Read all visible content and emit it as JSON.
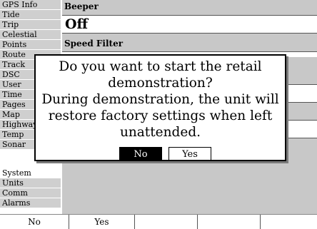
{
  "sidebar": {
    "items": [
      {
        "label": "GPS Info"
      },
      {
        "label": "Tide"
      },
      {
        "label": "Trip"
      },
      {
        "label": "Celestial"
      },
      {
        "label": "Points"
      },
      {
        "label": "Route"
      },
      {
        "label": "Track"
      },
      {
        "label": "DSC"
      },
      {
        "label": "User"
      },
      {
        "label": "Time"
      },
      {
        "label": "Pages"
      },
      {
        "label": "Map"
      },
      {
        "label": "Highway"
      },
      {
        "label": "Temp"
      },
      {
        "label": "Sonar"
      },
      {
        "label": "System"
      },
      {
        "label": "Units"
      },
      {
        "label": "Comm"
      },
      {
        "label": "Alarms"
      }
    ],
    "selected": "System"
  },
  "main": {
    "beeper_label": "Beeper",
    "beeper_value": "Off",
    "speed_filter_label": "Speed Filter"
  },
  "dialog": {
    "message_line1": "Do you want to start the retail",
    "message_line2": "demonstration?",
    "message_line3": "During demonstration, the unit will",
    "message_line4": "restore factory settings when left",
    "message_line5": "unattended.",
    "no_label": "No",
    "yes_label": "Yes",
    "selected": "No"
  },
  "softkeys": {
    "items": [
      {
        "label": "No"
      },
      {
        "label": "Yes"
      },
      {
        "label": ""
      },
      {
        "label": ""
      },
      {
        "label": ""
      }
    ]
  },
  "colors": {
    "background": "#c8c8c8",
    "highlight": "#000000",
    "panel": "#ffffff"
  }
}
